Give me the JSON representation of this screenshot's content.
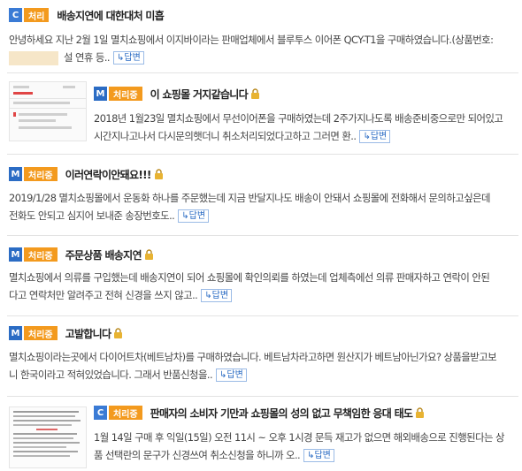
{
  "reply_label": "답변",
  "posts": [
    {
      "grade": "C",
      "status": "처리",
      "title": "배송지연에 대한대처 미흡",
      "locked": false,
      "lines": [
        "안녕하세요 지난 2월 1일 멸치쇼핑에서 이지바이라는 판매업체에서 블루투스 이어폰 QCY-T1을 구매하였습니다.(상품번호:",
        "설 연휴 등.."
      ]
    },
    {
      "grade": "M",
      "status": "처리중",
      "title": "이 쇼핑몰 거지같습니다",
      "locked": true,
      "lines": [
        "2018년 1월23일 멸치쇼핑에서 무선이어폰을 구매하였는데 2주가지나도록 배송준비중으로만 되어있고",
        "시간지나고나서 다시문의햇더니 취소처리되었다고하고 그러면 환.."
      ]
    },
    {
      "grade": "M",
      "status": "처리중",
      "title": "이러연락이안돼요!!!",
      "locked": true,
      "lines": [
        "2019/1/28 멸치쇼핑몰에서 운동화 하나를 주문했는데 지금 반달지나도 배송이 안돼서 쇼핑몰에 전화해서 문의하고싶은데",
        "전화도 안되고 심지어 보내준 송장번호도.."
      ]
    },
    {
      "grade": "M",
      "status": "처리중",
      "title": "주문상품 배송지연",
      "locked": true,
      "lines": [
        "멸치쇼핑에서 의류를 구입했는데 배송지연이 되어 쇼핑몰에 확인의뢰를 하였는데 업체측에선 의류 판매자하고 연락이 안된",
        "다고 연락처만 알려주고 전혀 신경을 쓰지 않고.."
      ]
    },
    {
      "grade": "M",
      "status": "처리중",
      "title": "고발합니다",
      "locked": true,
      "lines": [
        "멸치쇼핑이라는곳에서 다이어트차(베트남차)를 구매하였습니다. 베트남차라고하면 원산지가 베트남아닌가요? 상품을받고보",
        "니 한국이라고 적혀있었습니다. 그래서 반품신청을.."
      ]
    },
    {
      "grade": "C",
      "status": "처리중",
      "title": "판매자의 소비자 기만과 쇼핑몰의 성의 없고 무책임한 응대 태도",
      "locked": true,
      "lines": [
        "1월 14일 구매 후 익일(15일) 오전 11시 ~ 오후 1시경 문득 재고가 없으면 해외배송으로 진행된다는 상",
        "품 선택란의 문구가 신경쓰여 취소신청을 하니까 오.."
      ]
    }
  ]
}
